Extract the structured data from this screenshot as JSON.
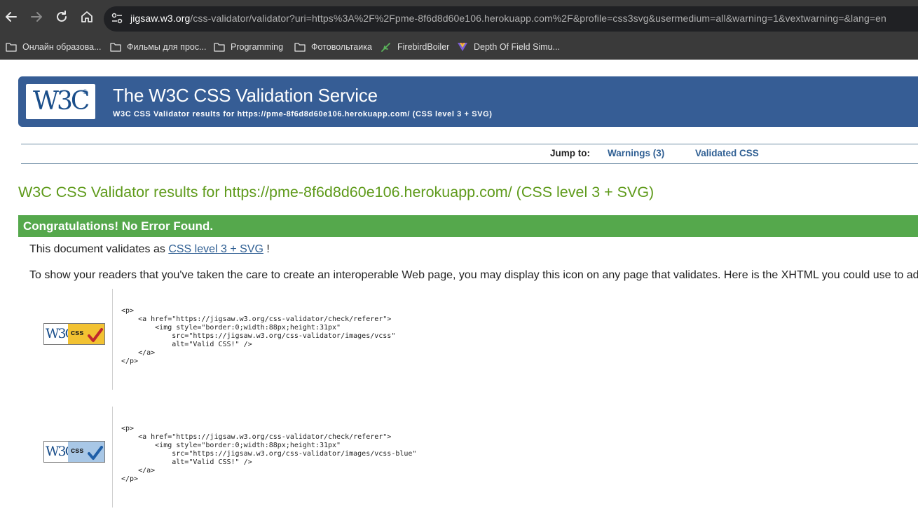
{
  "browser": {
    "url_host": "jigsaw.w3.org",
    "url_rest": "/css-validator/validator?uri=https%3A%2F%2Fpme-8f6d8d60e106.herokuapp.com%2F&profile=css3svg&usermedium=all&warning=1&vextwarning=&lang=en",
    "bookmarks": [
      {
        "label": "Онлайн образова...",
        "icon": "folder-icon"
      },
      {
        "label": "Фильмы для прос...",
        "icon": "folder-icon"
      },
      {
        "label": "Programming",
        "icon": "folder-icon"
      },
      {
        "label": "Фотовольтаика",
        "icon": "folder-icon"
      },
      {
        "label": "FirebirdBoiler",
        "icon": "bird-icon"
      },
      {
        "label": "Depth Of Field Simu...",
        "icon": "prism-icon"
      }
    ]
  },
  "banner": {
    "logo_text": "W3C",
    "title": "The W3C CSS Validation Service",
    "subtitle": "W3C CSS Validator results for https://pme-8f6d8d60e106.herokuapp.com/ (CSS level 3 + SVG)"
  },
  "jump": {
    "label": "Jump to:",
    "links": [
      "Warnings (3)",
      "Validated CSS"
    ]
  },
  "results": {
    "heading": "W3C CSS Validator results for https://pme-8f6d8d60e106.herokuapp.com/ (CSS level 3 + SVG)",
    "congrats": "Congratulations! No Error Found.",
    "validates_prefix": "This document validates as ",
    "validates_link": "CSS level 3 + SVG",
    "validates_suffix": " !",
    "readers_text": "To show your readers that you've taken the care to create an interoperable Web page, you may display this icon on any page that validates. Here is the XHTML you could use to ad"
  },
  "badges": [
    {
      "w3_text": "W3C",
      "css_text": "css",
      "color": "#f2c232",
      "check_color": "#c0282d",
      "code": "<p>\n    <a href=\"https://jigsaw.w3.org/css-validator/check/referer\">\n        <img style=\"border:0;width:88px;height:31px\"\n            src=\"https://jigsaw.w3.org/css-validator/images/vcss\"\n            alt=\"Valid CSS!\" />\n    </a>\n</p>"
    },
    {
      "w3_text": "W3C",
      "css_text": "css",
      "color": "#a8c7e6",
      "check_color": "#1f5fa8",
      "code": "<p>\n    <a href=\"https://jigsaw.w3.org/css-validator/check/referer\">\n        <img style=\"border:0;width:88px;height:31px\"\n            src=\"https://jigsaw.w3.org/css-validator/images/vcss-blue\"\n            alt=\"Valid CSS!\" />\n    </a>\n</p>"
    }
  ],
  "colors": {
    "banner": "#365d95",
    "heading": "#5e9a1a",
    "congrats": "#55a84c",
    "link": "#2f5f93"
  }
}
